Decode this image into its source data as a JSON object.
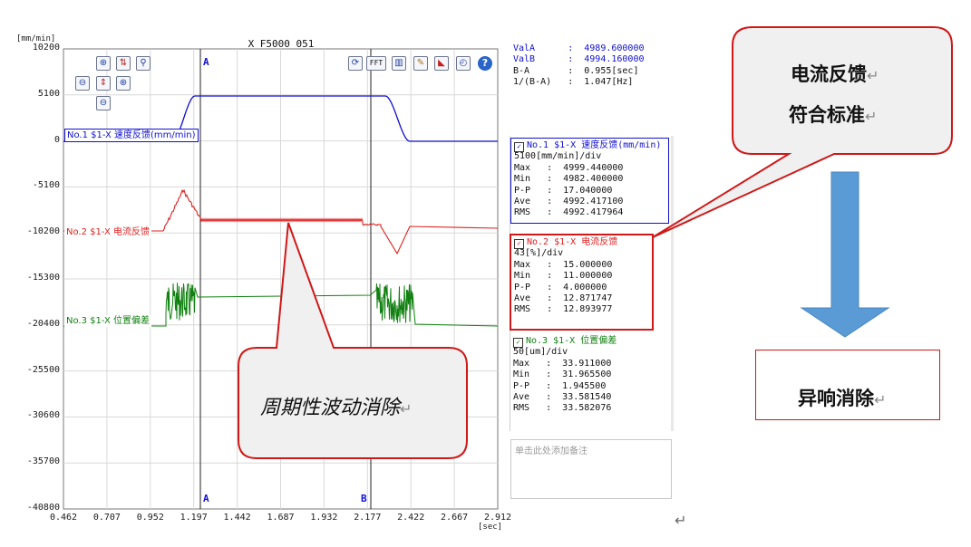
{
  "plot": {
    "title": "X_F5000_051",
    "y_unit": "[mm/min]",
    "x_unit": "[sec]",
    "y_ticks": [
      "10200",
      "5100",
      "0",
      "-5100",
      "-10200",
      "-15300",
      "-20400",
      "-25500",
      "-30600",
      "-35700",
      "-40800"
    ],
    "x_ticks": [
      "0.462",
      "0.707",
      "0.952",
      "1.197",
      "1.442",
      "1.687",
      "1.932",
      "2.177",
      "2.422",
      "2.667",
      "2.912"
    ],
    "cursor_a_label": "A",
    "cursor_b_label": "B",
    "toolbar_left": [
      "zoom-in-x-icon",
      "cursor-lines-icon",
      "zoom-search-icon",
      "zoom-out-x-icon",
      "fit-vertical-icon",
      "zoom-in-y-icon",
      "zoom-out-y-icon"
    ],
    "toolbar_right": [
      "refresh-icon",
      "fft-icon",
      "histogram-icon",
      "pencil-icon",
      "chart-area-icon",
      "gauge-icon",
      "help-icon"
    ],
    "fft_label": "FFT",
    "channels": [
      {
        "label": "No.1 $1-X 速度反馈(mm/min)",
        "color": "#1010d0"
      },
      {
        "label": "No.2 $1-X 电流反馈",
        "color": "#e02020"
      },
      {
        "label": "No.3 $1-X 位置偏差",
        "color": "#108010"
      }
    ]
  },
  "cursor_readout": {
    "line1": "ValA      :  4989.600000",
    "line2": "ValB      :  4994.160000",
    "line3": "B-A       :  0.955[sec]",
    "line4": "1/(B-A)   :  1.047[Hz]"
  },
  "stats": [
    {
      "title": "No.1 $1-X 速度反馈(mm/min)",
      "div": "5100[mm/min]/div",
      "lines": [
        "Max   :  4999.440000",
        "Min   :  4982.400000",
        "P-P   :  17.040000",
        "Ave   :  4992.417100",
        "RMS   :  4992.417964"
      ],
      "color": "#1010d0"
    },
    {
      "title": "No.2 $1-X 电流反馈",
      "div": "43[%]/div",
      "lines": [
        "Max   :  15.000000",
        "Min   :  11.000000",
        "P-P   :  4.000000",
        "Ave   :  12.871747",
        "RMS   :  12.893977"
      ],
      "color": "#e02020"
    },
    {
      "title": "No.3 $1-X 位置偏差",
      "div": "50[um]/div",
      "lines": [
        "Max   :  33.911000",
        "Min   :  31.965500",
        "P-P   :  1.945500",
        "Ave   :  33.581540",
        "RMS   :  33.582076"
      ],
      "color": "#108010"
    }
  ],
  "memo_placeholder": "单击此处添加备注",
  "callouts": {
    "current_line1": "电流反馈",
    "current_line2": "符合标准",
    "periodic": "周期性波动消除",
    "noise": "异响消除"
  },
  "colors": {
    "callout_border": "#d01818",
    "callout_fill": "#f0f0f0",
    "arrow_fill": "#5b9bd5",
    "grid": "#d8d8d8"
  }
}
